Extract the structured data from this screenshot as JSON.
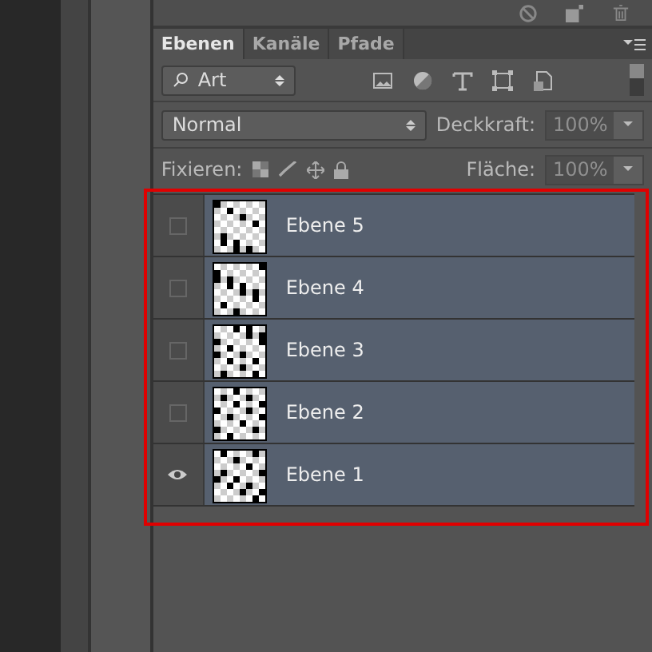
{
  "tabs": [
    {
      "label": "Ebenen",
      "selected": true
    },
    {
      "label": "Kanäle",
      "selected": false
    },
    {
      "label": "Pfade",
      "selected": false
    }
  ],
  "filter": {
    "value": "Art"
  },
  "blend_mode": {
    "value": "Normal"
  },
  "opacity": {
    "label": "Deckkraft:",
    "value": "100%",
    "disabled": true
  },
  "lock": {
    "label": "Fixieren:"
  },
  "fill": {
    "label": "Fläche:",
    "value": "100%",
    "disabled": true
  },
  "layers": [
    {
      "name": "Ebene 5",
      "visible": false,
      "selected": true
    },
    {
      "name": "Ebene 4",
      "visible": false,
      "selected": true
    },
    {
      "name": "Ebene 3",
      "visible": false,
      "selected": true
    },
    {
      "name": "Ebene 2",
      "visible": false,
      "selected": true
    },
    {
      "name": "Ebene 1",
      "visible": true,
      "selected": true
    }
  ]
}
